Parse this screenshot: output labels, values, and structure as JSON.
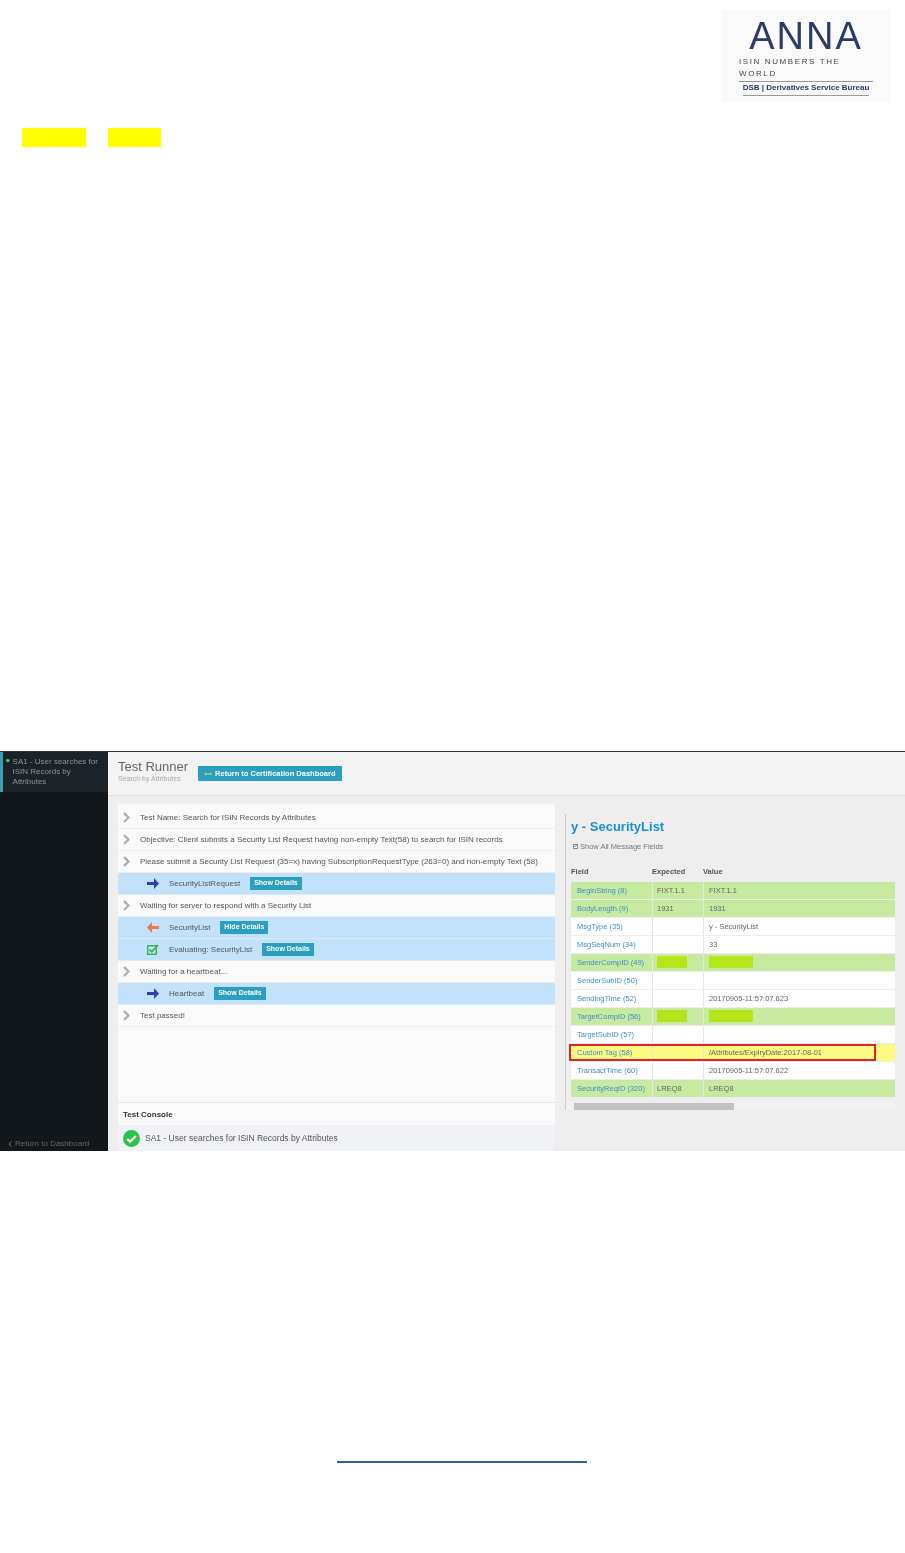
{
  "logo": {
    "wordmark": "ANNA",
    "tagline": "ISIN NUMBERS THE WORLD",
    "subtitle": "DSB | Derivatives Service Bureau"
  },
  "redactions": [
    {
      "kind": "highlight"
    },
    {
      "kind": "highlight"
    }
  ],
  "screenshot": {
    "sidebar": {
      "items": [
        {
          "label": "SA1 - User searches for ISIN Records by Attributes",
          "selected": true,
          "passed": true
        }
      ],
      "footer_link": "Return to Dashboard"
    },
    "header": {
      "title": "Test Runner",
      "subtitle": "Search by Attributes",
      "button": "Return to Certification Dashboard"
    },
    "steps": [
      {
        "kind": "step",
        "text": "Test Name: Search for ISIN Records by Attributes"
      },
      {
        "kind": "step",
        "text": "Objective: Client submits a Security List Request having non-empty Text(58) to search for ISIN records"
      },
      {
        "kind": "step",
        "text": "Please submit a Security List Request (35=x) having SubscriptionRequestType (263=0) and non-empty Text (58)"
      },
      {
        "kind": "outgoing",
        "text": "SecurityListRequest",
        "button": "Show Details"
      },
      {
        "kind": "step",
        "text": "Waiting for server to respond with a Security List"
      },
      {
        "kind": "incoming",
        "text": "SecurityList",
        "button": "Hide Details"
      },
      {
        "kind": "evaluation",
        "text": "Evaluating: SecurityList",
        "button": "Show Details"
      },
      {
        "kind": "step",
        "text": "Waiting for a heartbeat..."
      },
      {
        "kind": "outgoing",
        "text": "Heartbeat",
        "button": "Show Details"
      },
      {
        "kind": "step",
        "text": "Test passed!"
      }
    ],
    "console": {
      "title": "Test Console",
      "entries": [
        {
          "text": "SA1 - User searches for ISIN Records by Attributes",
          "passed": true
        }
      ]
    },
    "details": {
      "title": "y - SecurityList",
      "show_all": {
        "label": "Show All Message Fields",
        "checked": true
      },
      "columns": [
        "Field",
        "Expected",
        "Value"
      ],
      "rows": [
        {
          "matched": true,
          "highlighted": false,
          "field": "BeginString (8)",
          "expected": "FIXT.1.1",
          "value": "FIXT.1.1"
        },
        {
          "matched": true,
          "highlighted": false,
          "field": "BodyLength (9)",
          "expected": "1931",
          "value": "1931"
        },
        {
          "matched": false,
          "highlighted": false,
          "field": "MsgType (35)",
          "value": "y - SecurityList"
        },
        {
          "matched": false,
          "highlighted": false,
          "field": "MsgSeqNum (34)",
          "value": "33"
        },
        {
          "matched": true,
          "highlighted": false,
          "field": "SenderCompID (49)",
          "expected_redacted": true,
          "value_redacted": true
        },
        {
          "matched": false,
          "highlighted": false,
          "field": "SenderSubID (50)"
        },
        {
          "matched": false,
          "highlighted": false,
          "field": "SendingTime (52)",
          "value": "20170905-11:57:07.623"
        },
        {
          "matched": true,
          "highlighted": false,
          "field": "TargetCompID (56)",
          "expected_redacted": true,
          "value_redacted": true
        },
        {
          "matched": false,
          "highlighted": false,
          "field": "TargetSubID (57)"
        },
        {
          "matched": false,
          "highlighted": true,
          "field": "Custom Tag (58)",
          "value": "/Attributes/ExpiryDate:2017-08-01"
        },
        {
          "matched": false,
          "highlighted": false,
          "field": "TransactTime (60)",
          "value": "20170905-11:57:07.622"
        },
        {
          "matched": true,
          "highlighted": false,
          "field": "SecurityReqID (320)",
          "expected": "LREQ8",
          "value": "LREQ8"
        }
      ]
    }
  }
}
